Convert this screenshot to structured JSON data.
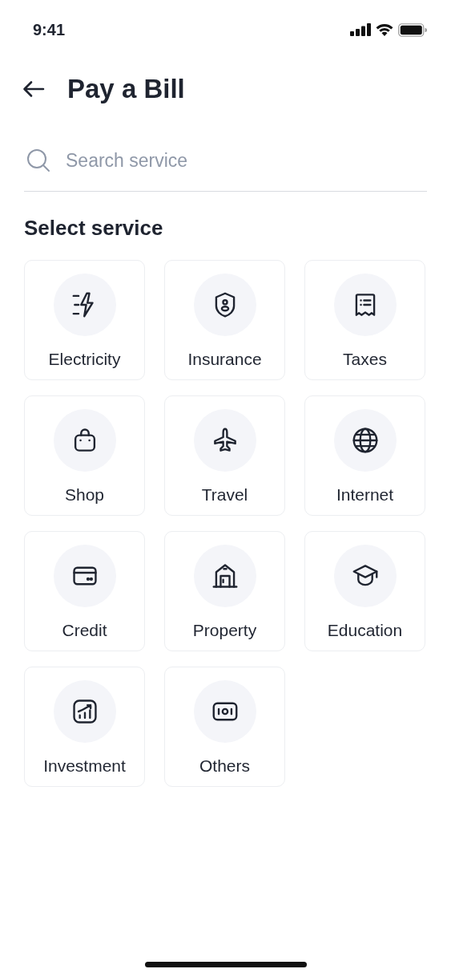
{
  "status_bar": {
    "time": "9:41"
  },
  "header": {
    "title": "Pay a Bill"
  },
  "search": {
    "placeholder": "Search service"
  },
  "section_title": "Select service",
  "services": [
    {
      "label": "Electricity"
    },
    {
      "label": "Insurance"
    },
    {
      "label": "Taxes"
    },
    {
      "label": "Shop"
    },
    {
      "label": "Travel"
    },
    {
      "label": "Internet"
    },
    {
      "label": "Credit"
    },
    {
      "label": "Property"
    },
    {
      "label": "Education"
    },
    {
      "label": "Investment"
    },
    {
      "label": "Others"
    }
  ]
}
